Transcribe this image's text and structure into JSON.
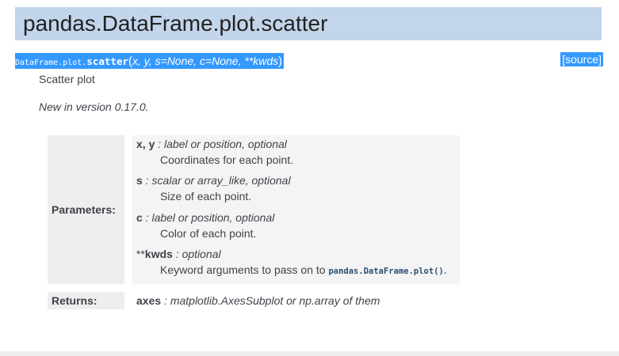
{
  "title": "pandas.DataFrame.plot.scatter",
  "signature": {
    "prefix": "DataFrame.plot.",
    "name": "scatter",
    "open_paren": "(",
    "params": "x, y, s=None, c=None, **kwds",
    "close_paren": ")"
  },
  "source_link": "[source]",
  "summary": "Scatter plot",
  "version_note": "New in version 0.17.0.",
  "parameters": {
    "label": "Parameters:",
    "items": [
      {
        "name": "x, y",
        "type": " : label or position, optional",
        "desc": "Coordinates for each point."
      },
      {
        "name": "s",
        "type": " : scalar or array_like, optional",
        "desc": "Size of each point."
      },
      {
        "name": "c",
        "type": " : label or position, optional",
        "desc": "Color of each point."
      },
      {
        "name_prefix": "**",
        "name": "kwds",
        "type": " : optional",
        "desc": "Keyword arguments to pass on to ",
        "code": "pandas.DataFrame.plot()",
        "desc_end": "."
      }
    ]
  },
  "returns": {
    "label": "Returns:",
    "name": "axes",
    "type": " : matplotlib.AxesSubplot or np.array of them"
  }
}
